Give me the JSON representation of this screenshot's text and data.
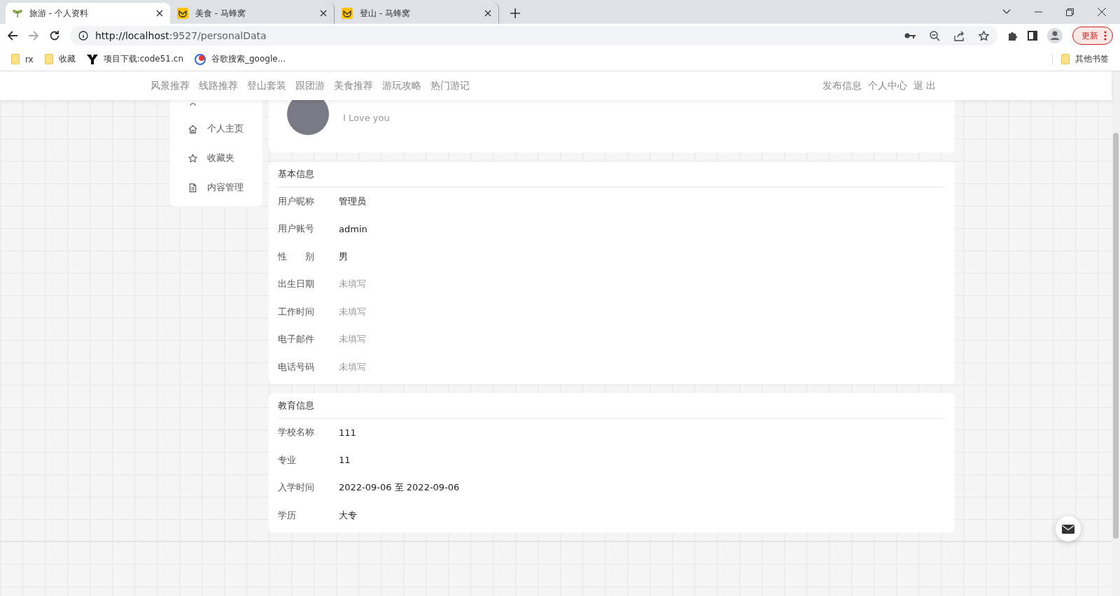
{
  "browser": {
    "tabs": [
      {
        "title": "旅游 - 个人资料",
        "selected": true,
        "kind": "sprout"
      },
      {
        "title": "美食 - 马蜂窝",
        "selected": false,
        "kind": "mfw"
      },
      {
        "title": "登山 - 马蜂窝",
        "selected": false,
        "kind": "mfw"
      }
    ],
    "address": {
      "host": "http://localhost",
      "rest": ":9527/personalData"
    },
    "update_button": "更新",
    "bookmarks": [
      {
        "label": "rx",
        "kind": "folder"
      },
      {
        "label": "收藏",
        "kind": "folder"
      },
      {
        "label": "项目下载:code51.cn",
        "kind": "y"
      },
      {
        "label": "谷歌搜索_google...",
        "kind": "g"
      }
    ],
    "other_bookmarks": "其他书签"
  },
  "navbar": {
    "links": [
      "风景推荐",
      "线路推荐",
      "登山套装",
      "跟团游",
      "美食推荐",
      "游玩攻略",
      "热门游记"
    ],
    "right_links": [
      "发布信息",
      "个人中心",
      "退 出"
    ]
  },
  "sidebar": {
    "items": [
      {
        "label": "个人主页",
        "kind": "home"
      },
      {
        "label": "收藏夹",
        "kind": "star"
      },
      {
        "label": "内容管理",
        "kind": "doc"
      }
    ]
  },
  "profile": {
    "motto": "I Love you"
  },
  "basic_info": {
    "title": "基本信息",
    "fields": [
      {
        "label": "用户昵称",
        "value": "管理员",
        "filled": true
      },
      {
        "label": "用户账号",
        "value": "admin",
        "filled": true
      },
      {
        "label": "性　　别",
        "value": "男",
        "filled": true
      },
      {
        "label": "出生日期",
        "value": "未填写",
        "filled": false
      },
      {
        "label": "工作时间",
        "value": "未填写",
        "filled": false
      },
      {
        "label": "电子邮件",
        "value": "未填写",
        "filled": false
      },
      {
        "label": "电话号码",
        "value": "未填写",
        "filled": false
      }
    ]
  },
  "education_info": {
    "title": "教育信息",
    "fields": [
      {
        "label": "学校名称",
        "value": "111",
        "filled": true
      },
      {
        "label": "专业",
        "value": "11",
        "filled": true
      },
      {
        "label": "入学时间",
        "value": "2022-09-06 至 2022-09-06",
        "filled": true
      },
      {
        "label": "学历",
        "value": "大专",
        "filled": true
      }
    ]
  }
}
